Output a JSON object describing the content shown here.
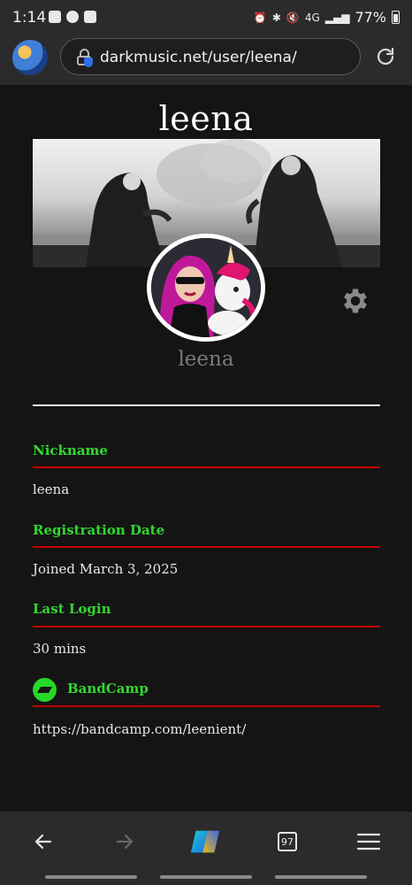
{
  "status_bar": {
    "time": "1:14",
    "network": "4G",
    "battery": "77%"
  },
  "browser": {
    "url": "darkmusic.net/user/leena/"
  },
  "profile": {
    "title": "leena",
    "display_name": "leena"
  },
  "fields": {
    "nickname": {
      "label": "Nickname",
      "value": "leena"
    },
    "registration": {
      "label": "Registration Date",
      "value": "Joined March 3, 2025"
    },
    "last_login": {
      "label": "Last Login",
      "value": "30 mins"
    },
    "bandcamp": {
      "label": "BandCamp",
      "value": "https://bandcamp.com/leenient/"
    }
  },
  "bottom_nav": {
    "tab_count": "97"
  },
  "colors": {
    "label_green": "#2fd82f",
    "divider_red": "#c80000",
    "background": "#141414"
  }
}
